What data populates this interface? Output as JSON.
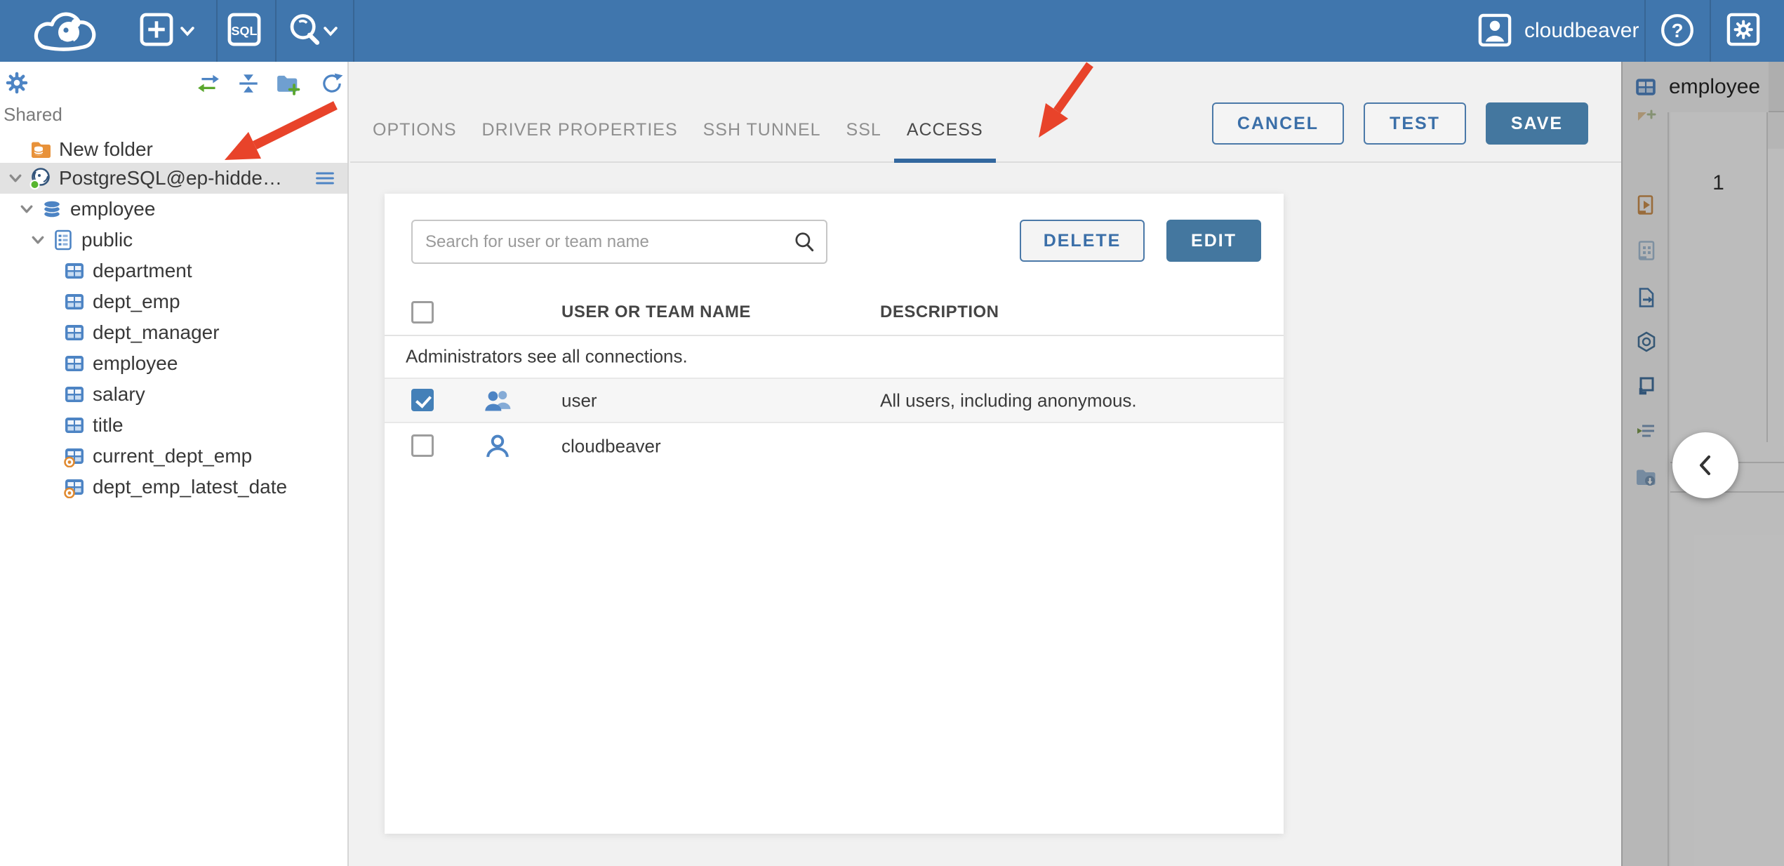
{
  "colors": {
    "topbar": "#4076ad",
    "accent_blue": "#3b6fa8",
    "button_fill": "#44779f",
    "tab_underline": "#33689f",
    "annotation_red": "#e8432a",
    "checkbox_checked": "#4480b8"
  },
  "topbar": {
    "sql_label": "SQL",
    "help_label": "?",
    "user_label": "cloudbeaver"
  },
  "sidebar": {
    "section_label": "Shared",
    "tree": [
      {
        "label": "New folder",
        "icon": "folder-database",
        "level": 0
      },
      {
        "label": "PostgreSQL@ep-hidden-...",
        "icon": "postgresql",
        "level": 0,
        "selected": true,
        "expanded": true
      },
      {
        "label": "employee",
        "icon": "database",
        "level": 1,
        "expanded": true
      },
      {
        "label": "public",
        "icon": "schema",
        "level": 2,
        "expanded": true
      },
      {
        "label": "department",
        "icon": "table",
        "level": 3
      },
      {
        "label": "dept_emp",
        "icon": "table",
        "level": 3
      },
      {
        "label": "dept_manager",
        "icon": "table",
        "level": 3
      },
      {
        "label": "employee",
        "icon": "table",
        "level": 3
      },
      {
        "label": "salary",
        "icon": "table",
        "level": 3
      },
      {
        "label": "title",
        "icon": "table",
        "level": 3
      },
      {
        "label": "current_dept_emp",
        "icon": "view",
        "level": 3
      },
      {
        "label": "dept_emp_latest_date",
        "icon": "view",
        "level": 3
      }
    ]
  },
  "main": {
    "tabs": [
      {
        "label": "OPTIONS"
      },
      {
        "label": "DRIVER PROPERTIES"
      },
      {
        "label": "SSH TUNNEL"
      },
      {
        "label": "SSL"
      },
      {
        "label": "ACCESS"
      }
    ],
    "active_tab": "ACCESS",
    "buttons": {
      "cancel": "CANCEL",
      "test": "TEST",
      "save": "SAVE"
    },
    "access": {
      "search_placeholder": "Search for user or team name",
      "delete_label": "DELETE",
      "edit_label": "EDIT",
      "columns": {
        "name": "USER OR TEAM NAME",
        "description": "DESCRIPTION"
      },
      "notice": "Administrators see all connections.",
      "rows": [
        {
          "name": "user",
          "description": "All users, including anonymous.",
          "checked": true,
          "icon": "team"
        },
        {
          "name": "cloudbeaver",
          "description": "",
          "checked": false,
          "icon": "user"
        }
      ]
    }
  },
  "right_panel": {
    "tab_label": "employee",
    "row_number": "1"
  }
}
